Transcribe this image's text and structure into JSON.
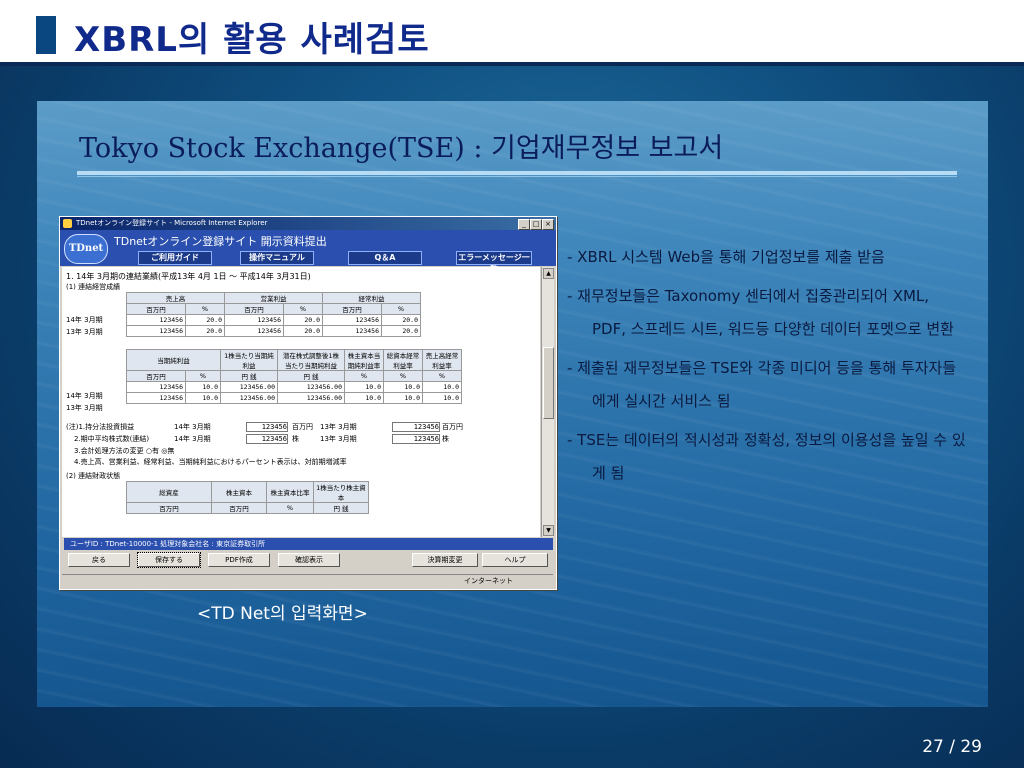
{
  "slide": {
    "title": "XBRL의 활용 사례검토",
    "subtitle": "Tokyo Stock Exchange(TSE) : 기업재무정보 보고서",
    "caption": "<TD Net의 입력화면>",
    "page": "27 / 29"
  },
  "bullets": [
    "- XBRL 시스템 Web을 통해 기업정보를 제출 받음",
    "- 재무정보들은 Taxonomy 센터에서 집중관리되어 XML, PDF, 스프레드 시트, 워드등 다양한 데이터 포멧으로 변환",
    "- 제출된 재무정보들은 TSE와 각종 미디어 등을 통해 투자자들에게 실시간 서비스 됨",
    "- TSE는 데이터의 적시성과 정확성, 정보의 이용성을 높일 수 있게 됨"
  ],
  "browser": {
    "window_title": "TDnetオンライン登録サイト - Microsoft Internet Explorer",
    "logo": "TDnet",
    "site_title": "TDnetオンライン登録サイト  開示資料提出",
    "nav": [
      "ご利用ガイド",
      "操作マニュアル",
      "Q＆A",
      "エラーメッセージ一覧"
    ],
    "lines": {
      "l1": "1. 14年 3月期の連結業績(平成13年 4月 1日 〜 平成14年 3月31日)",
      "l2": "(1) 連結経営成績",
      "l3": "(注)1.持分法投資損益",
      "l4": "2.期中平均株式数(連結)",
      "l5": "3.会計処理方法の変更    ○有  ◎無",
      "l6": "4.売上高、営業利益、経常利益、当期純利益におけるパーセント表示は、対前期増減率",
      "l7": "(2) 連結財政状態"
    },
    "table1": {
      "headers": [
        "売上高",
        "営業利益",
        "経常利益"
      ],
      "units": [
        "百万円",
        "%",
        "百万円",
        "%",
        "百万円",
        "%"
      ],
      "rows": [
        {
          "label": "14年 3月期",
          "values": [
            "123456",
            "20.0",
            "123456",
            "20.0",
            "123456",
            "20.0"
          ]
        },
        {
          "label": "13年 3月期",
          "values": [
            "123456",
            "20.0",
            "123456",
            "20.0",
            "123456",
            "20.0"
          ]
        }
      ]
    },
    "table2": {
      "headers": [
        "当期純利益",
        "1株当たり当期純利益",
        "潜在株式調整後1株当たり当期純利益",
        "株主資本当期純利益率",
        "総資本経常利益率",
        "売上高経常利益率"
      ],
      "units": [
        "百万円",
        "%",
        "円 銭",
        "円 銭",
        "%",
        "%",
        "%"
      ],
      "rows": [
        {
          "label": "14年 3月期",
          "values": [
            "123456",
            "10.0",
            "123456.00",
            "123456.00",
            "10.0",
            "10.0",
            "10.0"
          ]
        },
        {
          "label": "13年 3月期",
          "values": [
            "123456",
            "10.0",
            "123456.00",
            "123456.00",
            "10.0",
            "10.0",
            "10.0"
          ]
        }
      ]
    },
    "notes": {
      "n1a": "14年 3月期",
      "n1v": "123456",
      "n1u": "百万円",
      "n1b": "13年 3月期",
      "n1w": "123456",
      "n1x": "百万円",
      "n2a": "14年 3月期",
      "n2v": "123456",
      "n2u": "株",
      "n2b": "13年 3月期",
      "n2w": "123456",
      "n2x": "株"
    },
    "table3": [
      "総資産",
      "株主資本",
      "株主資本比率",
      "1株当たり株主資本"
    ],
    "table3_units": [
      "百万円",
      "百万円",
      "%",
      "円 銭"
    ],
    "user_bar": "ユーザID  : TDnet-10000-1                                    処理対象会社名  : 東京証券取引所",
    "buttons": [
      "戻る",
      "保存する",
      "PDF作成",
      "確認表示",
      "決算期変更",
      "ヘルプ"
    ],
    "status": "インターネット"
  }
}
